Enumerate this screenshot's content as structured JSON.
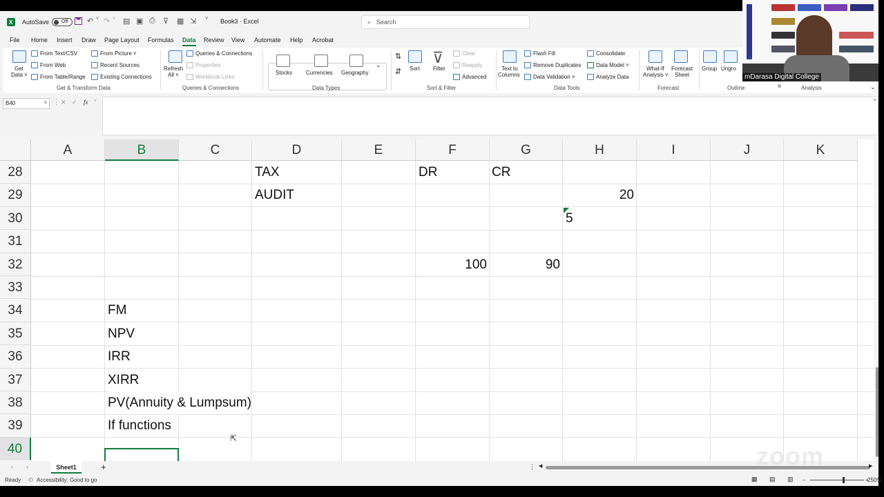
{
  "titlebar": {
    "autosave_label": "AutoSave",
    "autosave_state": "Off",
    "doc_title": "Book3 · Excel",
    "search_placeholder": "Search"
  },
  "menu": [
    "File",
    "Home",
    "Insert",
    "Draw",
    "Page Layout",
    "Formulas",
    "Data",
    "Review",
    "View",
    "Automate",
    "Help",
    "Acrobat"
  ],
  "menu_active": "Data",
  "ribbon": {
    "get_data": "Get Data",
    "get_data_line1": "Get",
    "get_data_line2": "Data ˅",
    "from_text_csv": "From Text/CSV",
    "from_web": "From Web",
    "from_table_range": "From Table/Range",
    "from_picture": "From Picture ˅",
    "recent_sources": "Recent Sources",
    "existing_connections": "Existing Connections",
    "group_get_transform": "Get & Transform Data",
    "refresh_all_line1": "Refresh",
    "refresh_all_line2": "All ˅",
    "queries_connections": "Queries & Connections",
    "properties": "Properties",
    "workbook_links": "Workbook Links",
    "group_queries": "Queries & Connections",
    "stocks": "Stocks",
    "currencies": "Currencies",
    "geography": "Geography",
    "group_data_types": "Data Types",
    "sort": "Sort",
    "filter": "Filter",
    "clear": "Clear",
    "reapply": "Reapply",
    "advanced": "Advanced",
    "group_sort_filter": "Sort & Filter",
    "text_to_columns_line1": "Text to",
    "text_to_columns_line2": "Columns",
    "flash_fill": "Flash Fill",
    "remove_duplicates": "Remove Duplicates",
    "data_validation": "Data Validation ˅",
    "consolidate": "Consolidate",
    "data_model": "Data Model ˅",
    "analyze_data": "Analyze Data",
    "group_data_tools": "Data Tools",
    "what_if_line1": "What-If",
    "what_if_line2": "Analysis ˅",
    "forecast_sheet_line1": "Forecast",
    "forecast_sheet_line2": "Sheet",
    "group_forecast": "Forecast",
    "group_btn": "Group",
    "ungroup_btn": "Ungro",
    "group_outline": "Outline",
    "group_analysis": "Analysis"
  },
  "formula_bar": {
    "name_box": "B40",
    "fx": "fx",
    "content": ""
  },
  "columns": [
    "A",
    "B",
    "C",
    "D",
    "E",
    "F",
    "G",
    "H",
    "I",
    "J",
    "K"
  ],
  "rows": [
    "28",
    "29",
    "30",
    "31",
    "32",
    "33",
    "34",
    "35",
    "36",
    "37",
    "38",
    "39",
    "40"
  ],
  "cells": {
    "D28": "TAX",
    "F28": "DR",
    "G28": "CR",
    "D29": "AUDIT",
    "H29": "20",
    "H30": "5",
    "F32": "100",
    "G32": "90",
    "B34": "FM",
    "B35": "NPV",
    "B36": "IRR",
    "B37": "XIRR",
    "B38": "PV(Annuity & Lumpsum)",
    "B39": "If functions"
  },
  "selected_cell": "B40",
  "sheet_tabs": [
    "Sheet1"
  ],
  "status": {
    "ready": "Ready",
    "accessibility": "Accessibility: Good to go",
    "zoom": "250%"
  },
  "video_overlay": {
    "name_label": "mDarasa Digital College",
    "watermark": "zoom"
  }
}
